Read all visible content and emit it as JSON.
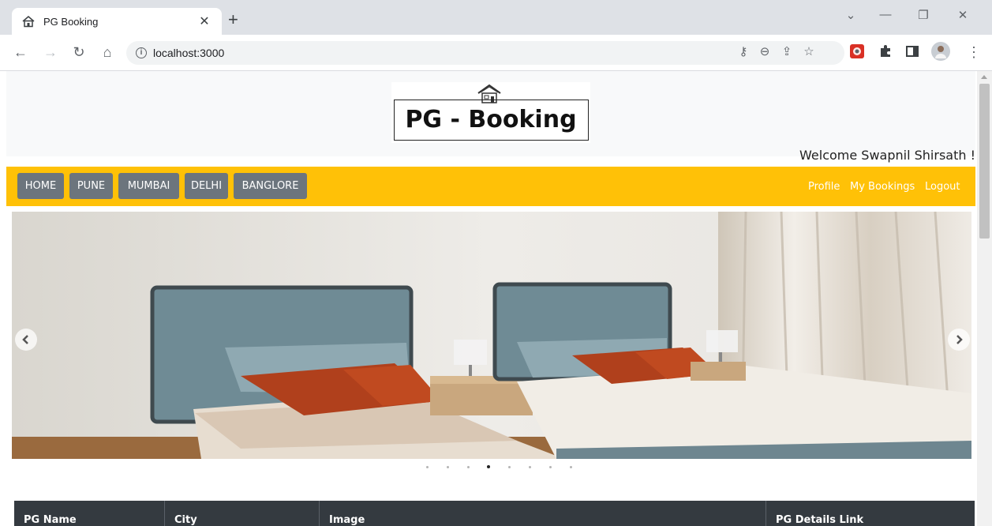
{
  "browser": {
    "tab_title": "PG Booking",
    "tab_close": "✕",
    "new_tab": "+",
    "url": "localhost:3000",
    "window_controls": [
      "⌄",
      "—",
      "❐",
      "✕"
    ]
  },
  "header": {
    "logo_text": "PG - Booking",
    "welcome": "Welcome Swapnil Shirsath !"
  },
  "nav": {
    "items": [
      "HOME",
      "PUNE",
      "MUMBAI",
      "DELHI",
      "BANGLORE"
    ],
    "right_links": [
      "Profile",
      "My Bookings",
      "Logout"
    ]
  },
  "carousel": {
    "slide_count": 8,
    "active_index": 3
  },
  "table": {
    "headers": [
      "PG Name",
      "City",
      "Image",
      "PG Details Link"
    ]
  },
  "colors": {
    "navbar": "#ffc107",
    "nav_button": "#6c757d",
    "table_header": "#343a40"
  }
}
